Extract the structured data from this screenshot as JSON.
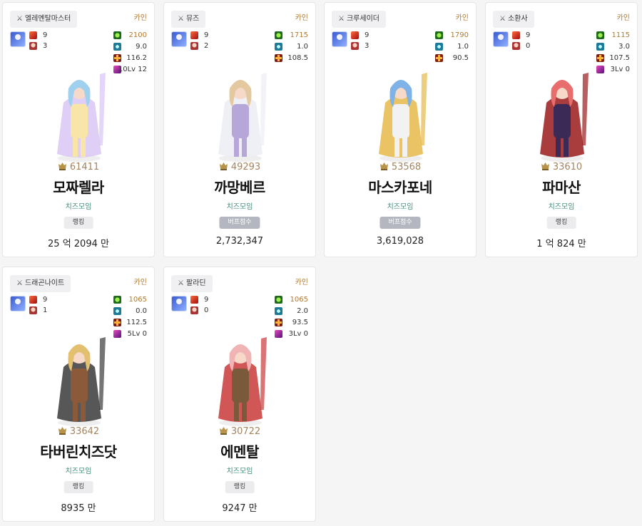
{
  "cards": [
    {
      "job": "엘레멘탈마스터",
      "coin_label": "카인",
      "count_a": "9",
      "count_b": "3",
      "stats": [
        "2100",
        "9.0",
        "116.2",
        "10Lv 12"
      ],
      "fame": "61411",
      "name": "모짜렐라",
      "guild": "치즈모임",
      "badge": "랭킹",
      "score": "25 억 2094 만",
      "art_colors": [
        "#d9c5f5",
        "#f7e6a8",
        "#9fd1ef"
      ]
    },
    {
      "job": "뮤즈",
      "coin_label": "카인",
      "count_a": "9",
      "count_b": "2",
      "stats": [
        "1715",
        "1.0",
        "108.5"
      ],
      "fame": "49293",
      "name": "까망베르",
      "guild": "치즈모임",
      "badge": "버프점수",
      "score": "2,732,347",
      "art_colors": [
        "#ececf5",
        "#b7a6d8",
        "#e4c9a0"
      ]
    },
    {
      "job": "크루세이더",
      "coin_label": "카인",
      "count_a": "9",
      "count_b": "3",
      "stats": [
        "1790",
        "1.0",
        "90.5"
      ],
      "fame": "53568",
      "name": "마스카포네",
      "guild": "치즈모임",
      "badge": "버프점수",
      "score": "3,619,028",
      "art_colors": [
        "#e6b84a",
        "#f2f2f2",
        "#7fb2e6"
      ]
    },
    {
      "job": "소환사",
      "coin_label": "카인",
      "count_a": "9",
      "count_b": "0",
      "stats": [
        "1115",
        "3.0",
        "107.5",
        "3Lv 0"
      ],
      "fame": "33610",
      "name": "파마산",
      "guild": "치즈모임",
      "badge": "랭킹",
      "score": "1 억 824 만",
      "art_colors": [
        "#9a1b1b",
        "#3b2a55",
        "#e86d6d"
      ]
    },
    {
      "job": "드래곤나이트",
      "coin_label": "카인",
      "count_a": "9",
      "count_b": "1",
      "stats": [
        "1065",
        "0.0",
        "112.5",
        "5Lv 0"
      ],
      "fame": "33642",
      "name": "타버린치즈닷",
      "guild": "치즈모임",
      "badge": "랭킹",
      "score": "8935 만",
      "art_colors": [
        "#3a3a3a",
        "#8a5a3a",
        "#e2c070"
      ]
    },
    {
      "job": "팔라딘",
      "coin_label": "카인",
      "count_a": "9",
      "count_b": "0",
      "stats": [
        "1065",
        "2.0",
        "93.5",
        "3Lv 0"
      ],
      "fame": "30722",
      "name": "에멘탈",
      "guild": "치즈모임",
      "badge": "랭킹",
      "score": "9247 만",
      "art_colors": [
        "#c93a3a",
        "#7a5a3a",
        "#f1b4b4"
      ]
    }
  ],
  "colors": {
    "coin_gold": "#b07a30",
    "fame_gold": "#a3845e",
    "guild_teal": "#3d8b7a"
  }
}
